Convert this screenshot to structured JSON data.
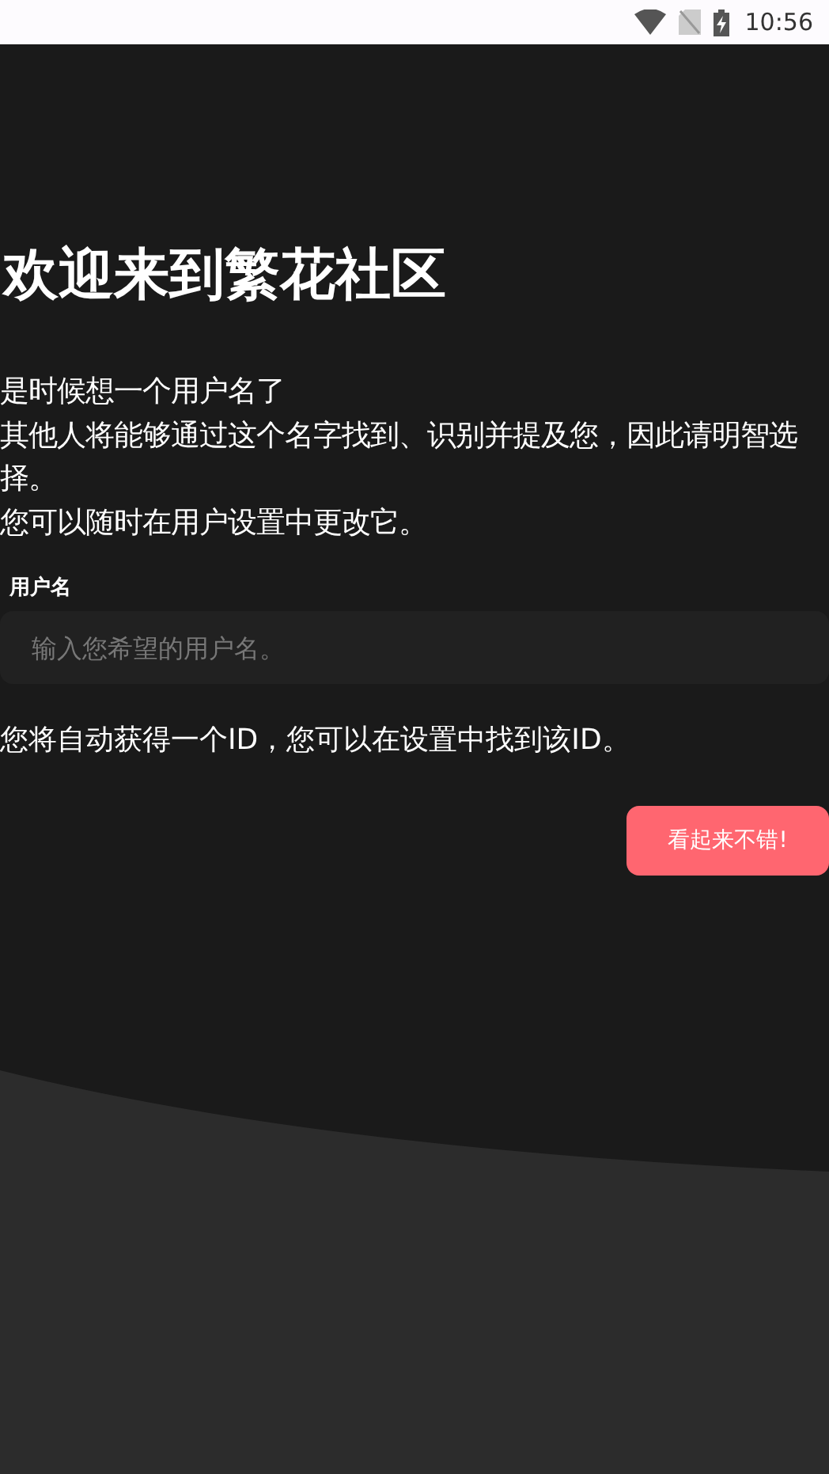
{
  "status_bar": {
    "time": "10:56"
  },
  "title": "欢迎来到繁花社区",
  "intro_lines": [
    "是时候想一个用户名了",
    "其他人将能够通过这个名字找到、识别并提及您，因此请明智选择。",
    "您可以随时在用户设置中更改它。"
  ],
  "username_field": {
    "label": "用户名",
    "placeholder": "输入您希望的用户名。"
  },
  "id_note": "您将自动获得一个ID，您可以在设置中找到该ID。",
  "confirm_button": "看起来不错!"
}
